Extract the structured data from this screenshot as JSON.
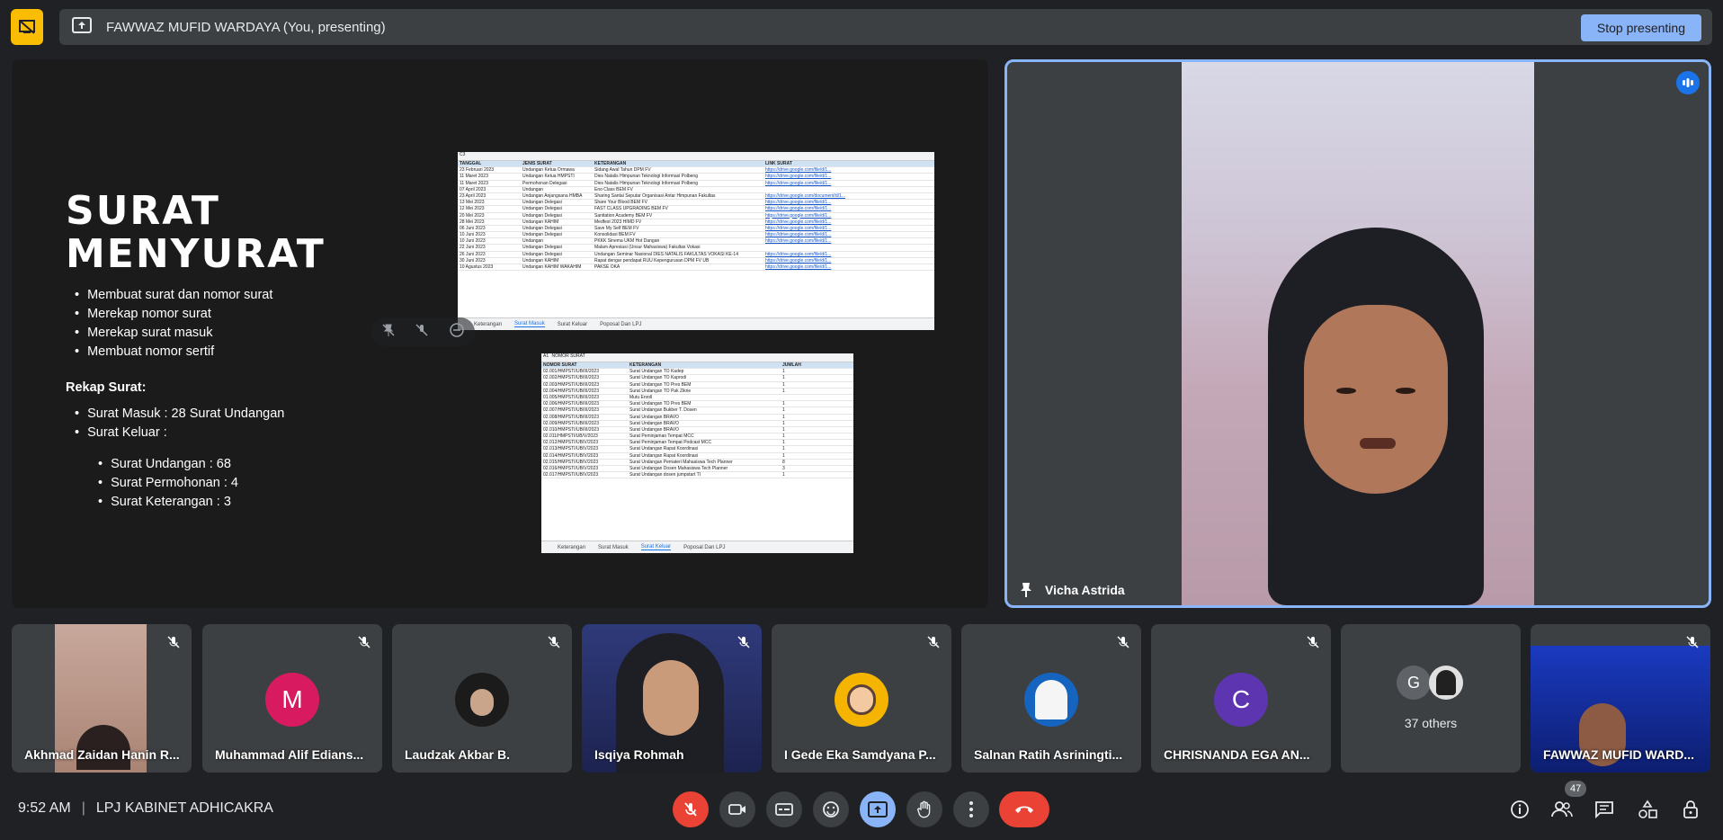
{
  "top": {
    "presenter_banner": "FAWWAZ MUFID WARDAYA (You, presenting)",
    "stop_label": "Stop presenting"
  },
  "slide": {
    "title_line1": "SURAT",
    "title_line2": "MENYURAT",
    "bullets": [
      "Membuat surat dan nomor surat",
      "Merekap nomor surat",
      "Merekap surat masuk",
      "Membuat nomor sertif"
    ],
    "rekap_title": "Rekap Surat:",
    "rekap_bullets": [
      "Surat Masuk : 28 Surat Undangan",
      "Surat Keluar :"
    ],
    "keluar_bullets": [
      "Surat Undangan : 68",
      "Surat Permohonan : 4",
      "Surat Keterangan : 3"
    ],
    "sheet1": {
      "cell_ref": "C3",
      "headers": [
        "TANGGAL",
        "JENIS SURAT",
        "KETERANGAN",
        "LINK SURAT"
      ],
      "rows": [
        [
          "23 Februari 2023",
          "Undangan Ketua Ormawa",
          "Sidang Awal Tahun DPM FV",
          "https://drive.google.com/file/d/1..."
        ],
        [
          "11 Maret 2023",
          "Undangan Ketua HMPSTI",
          "Dies Natalis Himpunan Teknologi Informasi Polbeng",
          "https://drive.google.com/file/d/1..."
        ],
        [
          "11 Maret 2023",
          "Permohonan Delegasi",
          "Dies Natalis Himpunan Teknologi Informasi Polbeng",
          "https://drive.google.com/file/d/1..."
        ],
        [
          "07 April 2023",
          "Undangan",
          "Eno Class BEM FV",
          ""
        ],
        [
          "23 April 2023",
          "Undangan Anjangsana HMBA",
          "Sharing Santai Seputar Organisasi Antar Himpunan Fakultas",
          "https://drive.google.com/document/d/1..."
        ],
        [
          "13 Mei 2023",
          "Undangan Delegasi",
          "Share Your Blood BEM FV",
          "https://drive.google.com/file/d/1..."
        ],
        [
          "12 Mei 2023",
          "Undangan Delegasi",
          "FAST CLASS UPGRADING BEM FV",
          "https://drive.google.com/file/d/1..."
        ],
        [
          "20 Mei 2023",
          "Undangan Delegasi",
          "Sanitation Academy BEM FV",
          "https://drive.google.com/file/d/1..."
        ],
        [
          "28 Mei 2023",
          "Undangan KAHIM",
          "Medfest 2023 HIMD FV",
          "https://drive.google.com/file/d/1..."
        ],
        [
          "06 Juni 2023",
          "Undangan Delegasi",
          "Save My Self BEM FV",
          "https://drive.google.com/file/d/1..."
        ],
        [
          "10 Juni 2023",
          "Undangan Delegasi",
          "Konsolidasi BEM FV",
          "https://drive.google.com/file/d/1..."
        ],
        [
          "10 Juni 2023",
          "Undangan",
          "PKKK Sinema UKM Hot Dangan",
          "https://drive.google.com/file/d/1..."
        ],
        [
          "22 Juni 2023",
          "Undangan Delegasi",
          "Malam Apresiasi (Unsur Mahasiswa) Fakultas Vokasi",
          ""
        ],
        [
          "26 Juni 2023",
          "Undangan Delegasi",
          "Undangan Seminar Nasional DIES NATALIS FAKULTAS VOKASI KE-14",
          "https://drive.google.com/file/d/1..."
        ],
        [
          "30 Juni 2023",
          "Undangan KAHIM",
          "Rapat dengar pendapat RUU Kepengurusan DPM FV UB",
          "https://drive.google.com/file/d/1..."
        ],
        [
          "10 Agustus 2023",
          "Undangan KAHIM WAKAHIM",
          "PAKSE OKA",
          "https://drive.google.com/file/d/1..."
        ]
      ],
      "tabs": [
        "Keterangan",
        "Surat Masuk",
        "Surat Keluar",
        "Poposal Dan LPJ"
      ]
    },
    "sheet2": {
      "cell_ref": "A1",
      "formula": "NOMOR SURAT",
      "headers": [
        "NOMOR SURAT",
        "KETERANGAN",
        "JUMLAH"
      ],
      "rows": [
        [
          "02.001/HMPSTI/UB/III/2023",
          "Surat Undangan TO Kadep",
          "1"
        ],
        [
          "02.002/HMPSTI/UB/III/2023",
          "Surat Undangan TO Kaprodi",
          "1"
        ],
        [
          "02.003/HMPSTI/UB/III/2023",
          "Surat Undangan TO Pres BEM",
          "1"
        ],
        [
          "02.004/HMPSTI/UB/III/2023",
          "Surat Undangan TO Pak Zikrie",
          "1"
        ],
        [
          "01.005/HMPSTI/UB/III/2023",
          "Mutu Enroll",
          ""
        ],
        [
          "02.006/HMPSTI/UB/III/2023",
          "Surat Undangan TO Pres BEM",
          "1"
        ],
        [
          "02.007/HMPSTI/UB/III/2023",
          "Surat Undangan Bukber T. Dosen",
          "1"
        ],
        [
          "02.008/HMPSTI/UB/III/2023",
          "Surat Undangan BRAVO",
          "1"
        ],
        [
          "02.009/HMPSTI/UB/III/2023",
          "Surat Undangan BRAVO",
          "1"
        ],
        [
          "02.010/HMPSTI/UB/III/2023",
          "Surat Undangan BRAVO",
          "1"
        ],
        [
          "02.011/HMPSTI/UB/V/2023",
          "Surat Peminjaman Tempat MCC",
          "1"
        ],
        [
          "02.012/HMPSTI/UB/V/2023",
          "Surat Peminjaman Tempat Podcast MCC",
          "1"
        ],
        [
          "02.013/HMPSTI/UB/V/2023",
          "Surat Undangan Rapat Koordinasi",
          "1"
        ],
        [
          "02.014/HMPSTI/UB/V/2023",
          "Surat Undangan Rapat Koordinasi",
          "1"
        ],
        [
          "02.015/HMPSTI/UB/V/2023",
          "Surat Undangan Pemateri Mahasiswa Tech Planner",
          "8"
        ],
        [
          "02.016/HMPSTI/UB/V/2023",
          "Surat Undangan Dosen Mahasiswa Tech Planner",
          "3"
        ],
        [
          "02.017/HMPSTI/UB/V/2023",
          "Surat Undangan dosen jumpstart TI",
          "1"
        ]
      ],
      "tabs": [
        "Keterangan",
        "Surat Masuk",
        "Surat Keluar",
        "Poposal Dan LPJ"
      ]
    }
  },
  "speaker": {
    "name": "Vicha Astrida"
  },
  "participants": [
    {
      "name": "Akhmad Zaidan Hanin R...",
      "initial": ""
    },
    {
      "name": "Muhammad Alif Edians...",
      "initial": "M",
      "color": "#d81b60"
    },
    {
      "name": "Laudzak Akbar B.",
      "initial": ""
    },
    {
      "name": "Isqiya Rohmah",
      "initial": ""
    },
    {
      "name": "I Gede Eka Samdyana P...",
      "initial": ""
    },
    {
      "name": "Salnan Ratih Asriningti...",
      "initial": ""
    },
    {
      "name": "CHRISNANDA EGA AN...",
      "initial": "C",
      "color": "#5e35b1"
    },
    {
      "name": "",
      "others": "37 others",
      "initial": "G"
    },
    {
      "name": "FAWWAZ MUFID WARD...",
      "initial": ""
    }
  ],
  "bottom": {
    "time": "9:52 AM",
    "meeting_name": "LPJ KABINET ADHICAKRA",
    "people_count": "47"
  },
  "colors": {
    "accent": "#8ab4f8",
    "hangup": "#ea4335",
    "banner_yellow": "#fbbc04"
  }
}
